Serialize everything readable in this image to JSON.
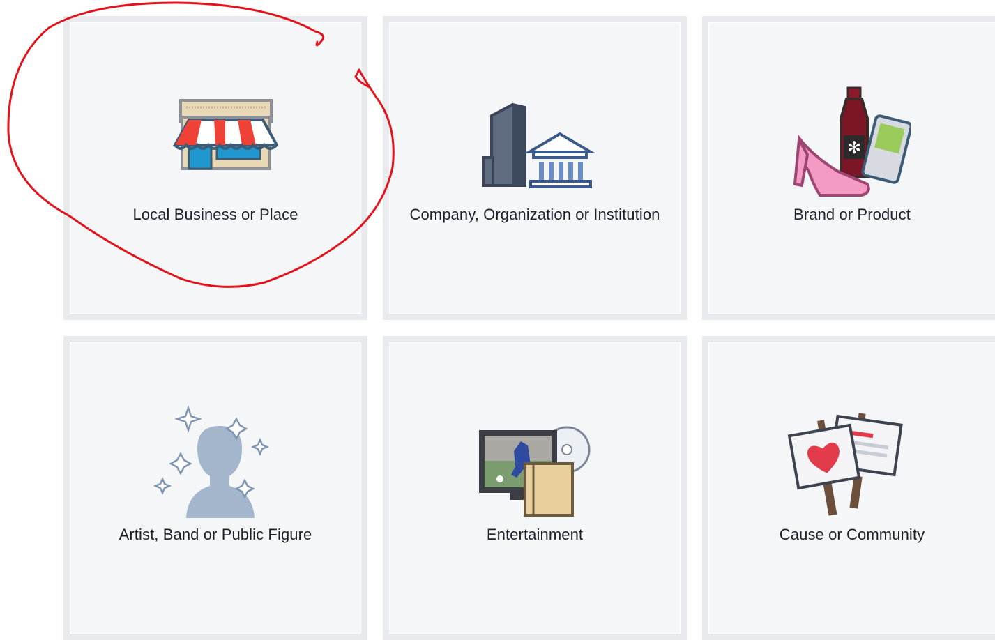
{
  "categories": [
    {
      "label": "Local Business or Place",
      "icon": "storefront-icon"
    },
    {
      "label": "Company, Organization or Institution",
      "icon": "buildings-icon"
    },
    {
      "label": "Brand or Product",
      "icon": "products-icon"
    },
    {
      "label": "Artist, Band or Public Figure",
      "icon": "public-figure-icon"
    },
    {
      "label": "Entertainment",
      "icon": "entertainment-icon"
    },
    {
      "label": "Cause or Community",
      "icon": "signs-icon"
    }
  ],
  "colors": {
    "card_bg": "#f5f6f8",
    "card_border": "#e9eaed",
    "label": "#1d2129",
    "annotation": "#e3131b"
  }
}
